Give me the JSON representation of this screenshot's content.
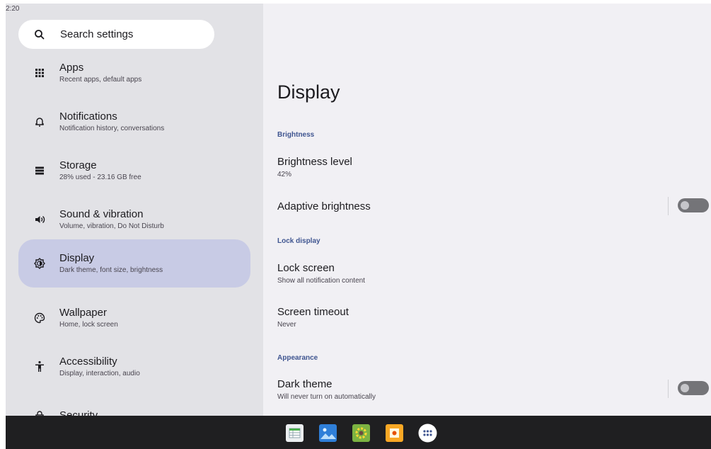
{
  "status_bar": {
    "time": "2:20"
  },
  "search": {
    "label": "Search settings",
    "icon": "search-icon"
  },
  "sidebar": {
    "items": [
      {
        "title": "Apps",
        "subtitle": "Recent apps, default apps",
        "icon": "apps-grid-icon"
      },
      {
        "title": "Notifications",
        "subtitle": "Notification history, conversations",
        "icon": "bell-icon"
      },
      {
        "title": "Storage",
        "subtitle": "28% used - 23.16 GB free",
        "icon": "storage-icon"
      },
      {
        "title": "Sound & vibration",
        "subtitle": "Volume, vibration, Do Not Disturb",
        "icon": "speaker-icon"
      },
      {
        "title": "Display",
        "subtitle": "Dark theme, font size, brightness",
        "icon": "brightness-icon",
        "active": true
      },
      {
        "title": "Wallpaper",
        "subtitle": "Home, lock screen",
        "icon": "palette-icon"
      },
      {
        "title": "Accessibility",
        "subtitle": "Display, interaction, audio",
        "icon": "accessibility-icon"
      },
      {
        "title": "Security",
        "subtitle": "",
        "icon": "lock-icon"
      }
    ]
  },
  "main": {
    "title": "Display",
    "sections": {
      "brightness": "Brightness",
      "lock_display": "Lock display",
      "appearance": "Appearance"
    },
    "prefs": {
      "brightness_level": {
        "title": "Brightness level",
        "subtitle": "42%"
      },
      "adaptive_brightness": {
        "title": "Adaptive brightness",
        "enabled": false
      },
      "lock_screen": {
        "title": "Lock screen",
        "subtitle": "Show all notification content"
      },
      "screen_timeout": {
        "title": "Screen timeout",
        "subtitle": "Never"
      },
      "dark_theme": {
        "title": "Dark theme",
        "subtitle": "Will never turn on automatically",
        "enabled": false
      }
    }
  },
  "taskbar": {
    "apps": [
      "sheets-app-icon",
      "gallery-app-icon",
      "settings-app-icon",
      "camera-app-icon",
      "all-apps-icon"
    ]
  },
  "colors": {
    "sidebar_bg": "#e2e2e6",
    "content_bg": "#f1f0f4",
    "active_item": "#c8cbe5",
    "section_header": "#3f5590",
    "taskbar_bg": "#1f1f21"
  }
}
